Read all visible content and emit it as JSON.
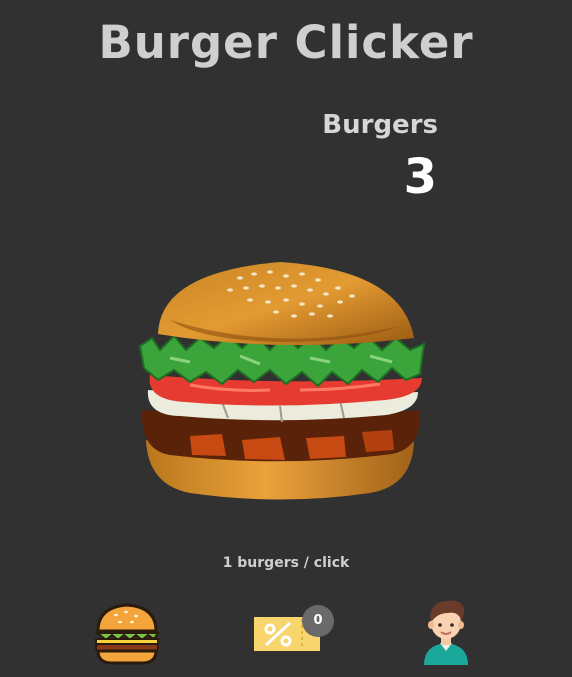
{
  "app": {
    "title": "Burger Clicker"
  },
  "counter": {
    "label": "Burgers",
    "value": "3"
  },
  "stats": {
    "rate_text": "1 burgers / click"
  },
  "nav": {
    "items": [
      {
        "icon": "burger-icon"
      },
      {
        "icon": "coupon-icon",
        "badge": "0"
      },
      {
        "icon": "profile-icon"
      }
    ]
  },
  "colors": {
    "background": "#313131",
    "title": "#cfcfcf",
    "counter_value": "#ffffff",
    "badge": "#6a6a6a",
    "coupon": "#f9d56e"
  }
}
